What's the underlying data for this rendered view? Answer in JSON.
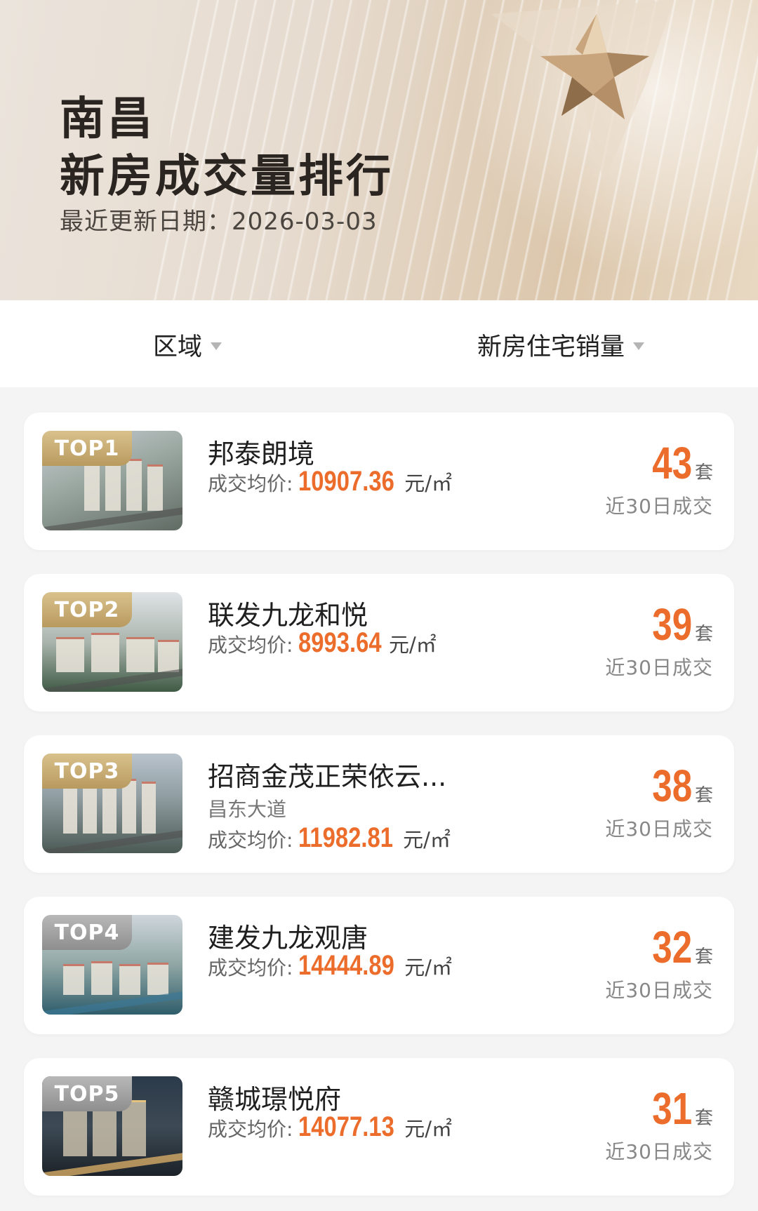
{
  "header": {
    "city": "南昌",
    "title": "新房成交量排行",
    "update_label": "最近更新日期：",
    "update_date": "2026-03-03"
  },
  "filters": {
    "region": "区域",
    "metric": "新房住宅销量"
  },
  "listings": [
    {
      "rank": "TOP1",
      "name": "邦泰朗境",
      "subtitle": "",
      "price_label": "成交均价:",
      "price": "10907.36",
      "price_unit": "元/㎡",
      "count": "43",
      "count_unit": "套",
      "count_note": "近30日成交"
    },
    {
      "rank": "TOP2",
      "name": "联发九龙和悦",
      "subtitle": "",
      "price_label": "成交均价:",
      "price": "8993.64",
      "price_unit": "元/㎡",
      "count": "39",
      "count_unit": "套",
      "count_note": "近30日成交"
    },
    {
      "rank": "TOP3",
      "name": "招商金茂正荣依云...",
      "subtitle": "昌东大道",
      "price_label": "成交均价:",
      "price": "11982.81",
      "price_unit": "元/㎡",
      "count": "38",
      "count_unit": "套",
      "count_note": "近30日成交"
    },
    {
      "rank": "TOP4",
      "name": "建发九龙观唐",
      "subtitle": "",
      "price_label": "成交均价:",
      "price": "14444.89",
      "price_unit": "元/㎡",
      "count": "32",
      "count_unit": "套",
      "count_note": "近30日成交"
    },
    {
      "rank": "TOP5",
      "name": "赣城璟悦府",
      "subtitle": "",
      "price_label": "成交均价:",
      "price": "14077.13",
      "price_unit": "元/㎡",
      "count": "31",
      "count_unit": "套",
      "count_note": "近30日成交"
    }
  ],
  "colors": {
    "accent": "#ec6d2b",
    "badge_gold": "#c9ad73",
    "badge_silver": "#a3a3a3"
  }
}
